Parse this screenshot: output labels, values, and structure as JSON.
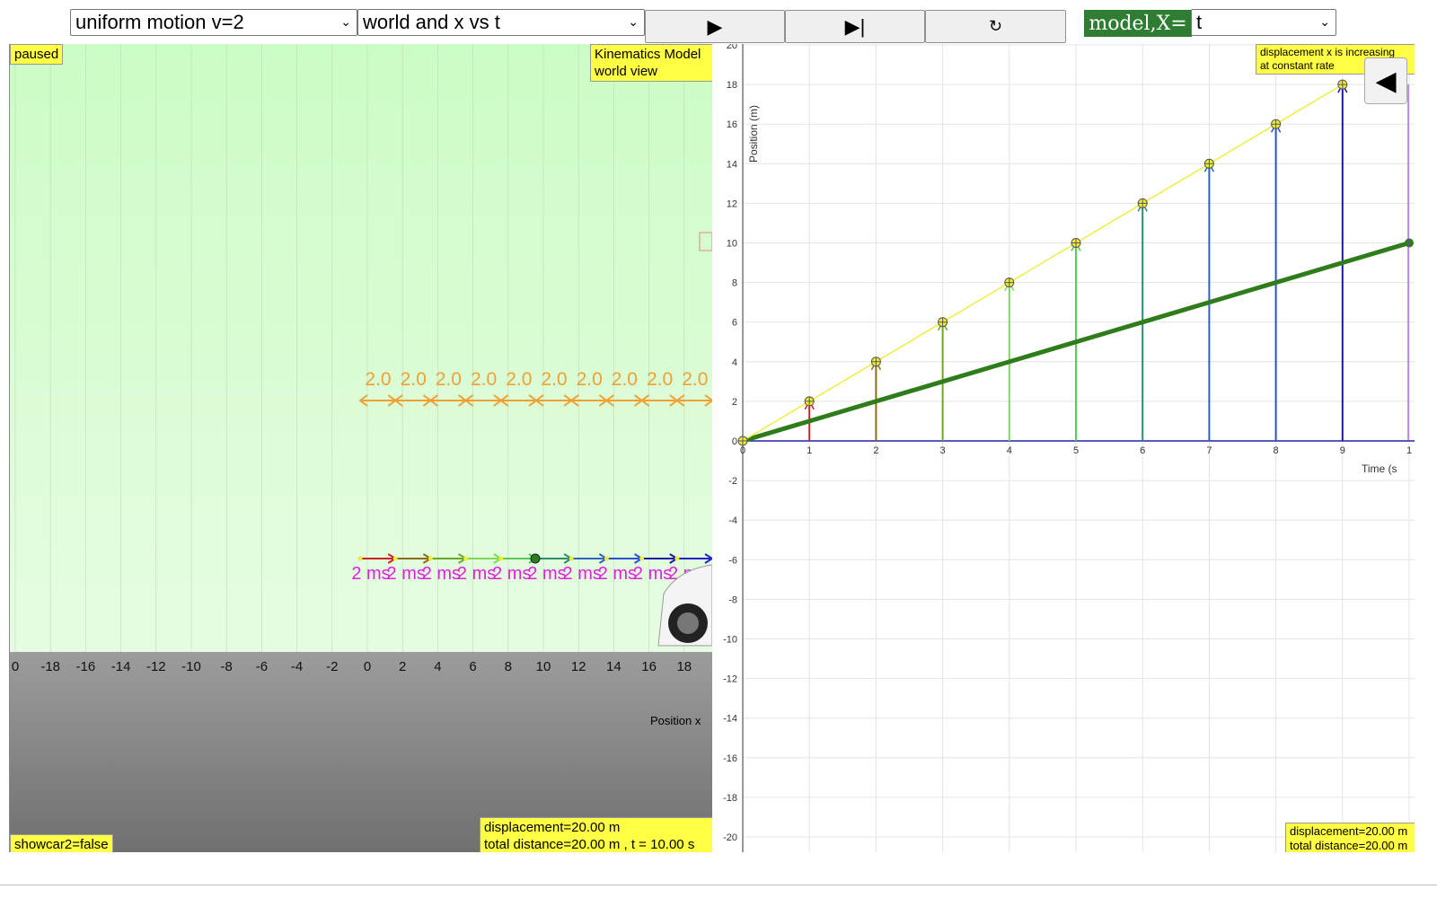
{
  "toolbar": {
    "scenario_select": "uniform motion v=2",
    "view_select": "world and x vs t",
    "play_icon": "▶",
    "step_icon": "▶|",
    "reset_icon": "↻",
    "model_label": "model,X=",
    "model_select": "t"
  },
  "world": {
    "status": "paused",
    "title_line1": "Kinematics Model",
    "title_line2": "world view",
    "axis_label": "Position x",
    "axis_ticks": [
      "0",
      "-18",
      "-16",
      "-14",
      "-12",
      "-10",
      "-8",
      "-6",
      "-4",
      "-2",
      "0",
      "2",
      "4",
      "6",
      "8",
      "10",
      "12",
      "14",
      "16",
      "18",
      "2"
    ],
    "displacement_labels": [
      "2.0",
      "2.0",
      "2.0",
      "2.0",
      "2.0",
      "2.0",
      "2.0",
      "2.0",
      "2.0",
      "2.0"
    ],
    "velocity_label": "2 ms",
    "readout_line1": "displacement=20.00 m",
    "readout_line2": "total distance=20.00 m , t = 10.00 s",
    "showcar_flag": "showcar2=false",
    "colors": {
      "displacement_arrows": "#f0a030",
      "velocity_text": "#e020e0"
    }
  },
  "graph": {
    "annotation_line1": "displacement x is increasing",
    "annotation_line2": "at constant rate",
    "readout_line1": "displacement=20.00 m",
    "readout_line2": "total distance=20.00 m",
    "back_icon": "◀"
  },
  "chart_data": {
    "type": "line",
    "xlabel": "Time (s",
    "ylabel": "Position (m)",
    "xlim": [
      0,
      10
    ],
    "ylim": [
      -20,
      20
    ],
    "x_ticks": [
      "0",
      "1",
      "2",
      "3",
      "4",
      "5",
      "6",
      "7",
      "8",
      "9",
      "1"
    ],
    "y_ticks": [
      "20",
      "18",
      "16",
      "14",
      "12",
      "10",
      "8",
      "6",
      "4",
      "2",
      "0",
      "-2",
      "-4",
      "-6",
      "-8",
      "-10",
      "-12",
      "-14",
      "-16",
      "-18",
      "-20"
    ],
    "grid": true,
    "series": [
      {
        "type": "line+markers",
        "color": "#eeee44",
        "x": [
          0,
          1,
          2,
          3,
          4,
          5,
          6,
          7,
          8,
          9
        ],
        "y": [
          0,
          2,
          4,
          6,
          8,
          10,
          12,
          14,
          16,
          18
        ]
      },
      {
        "type": "line",
        "color": "#2e7d1a",
        "x": [
          0,
          10
        ],
        "y": [
          0,
          10
        ]
      }
    ],
    "arrow_colors": [
      "#cc2222",
      "#8b6b14",
      "#6aa82a",
      "#7ed957",
      "#58c858",
      "#2e8b6b",
      "#3060c0",
      "#2a4fd0",
      "#1a1aa0"
    ]
  }
}
